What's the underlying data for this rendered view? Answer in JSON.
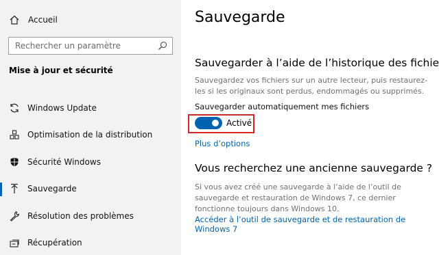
{
  "sidebar": {
    "home_label": "Accueil",
    "home_icon": "home-icon",
    "search_placeholder": "Rechercher un paramètre",
    "search_icon": "search-icon",
    "section_title": "Mise à jour et sécurité",
    "items": [
      {
        "label": "Windows Update",
        "icon": "refresh-icon",
        "active": false
      },
      {
        "label": "Optimisation de la distribution",
        "icon": "delivery-optimization-icon",
        "active": false
      },
      {
        "label": "Sécurité Windows",
        "icon": "shield-icon",
        "active": false
      },
      {
        "label": "Sauvegarde",
        "icon": "backup-arrow-icon",
        "active": true
      },
      {
        "label": "Résolution des problèmes",
        "icon": "wrench-icon",
        "active": false
      },
      {
        "label": "Récupération",
        "icon": "recovery-icon",
        "active": false
      }
    ]
  },
  "main": {
    "title": "Sauvegarde",
    "file_history": {
      "heading": "Sauvegarder à l’aide de l’historique des fichiers",
      "description": "Sauvegardez vos fichiers sur un autre lecteur, puis restaurez-les si les originaux sont perdus, endommagés ou supprimés.",
      "toggle_caption": "Sauvegarder automatiquement mes fichiers",
      "toggle_state": "Activé",
      "toggle_on": true,
      "more_options": "Plus d’options"
    },
    "old_backup": {
      "heading": "Vous recherchez une ancienne sauvegarde ?",
      "description": "Si vous avez créé une sauvegarde à l’aide de l’outil de sauvegarde et restauration de Windows 7, ce dernier fonctionne toujours dans Windows 10.",
      "link": "Accéder à l’outil de sauvegarde et de restauration de Windows 7"
    }
  },
  "colors": {
    "accent": "#0063b1",
    "highlight_border": "#d42525",
    "sidebar_bg": "#f2f2f2"
  }
}
